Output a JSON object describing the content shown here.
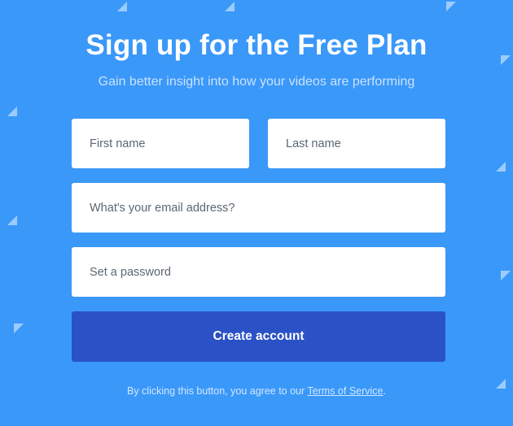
{
  "header": {
    "title": "Sign up for the Free Plan",
    "subtitle": "Gain better insight into how your videos are performing"
  },
  "form": {
    "first_name": {
      "placeholder": "First name",
      "value": ""
    },
    "last_name": {
      "placeholder": "Last name",
      "value": ""
    },
    "email": {
      "placeholder": "What's your email address?",
      "value": ""
    },
    "password": {
      "placeholder": "Set a password",
      "value": ""
    },
    "submit_label": "Create account"
  },
  "terms": {
    "prefix": "By clicking this button, you agree to our ",
    "link_text": "Terms of Service",
    "suffix": "."
  },
  "colors": {
    "background": "#3a98f9",
    "button": "#2a52c6",
    "field": "#ffffff"
  }
}
